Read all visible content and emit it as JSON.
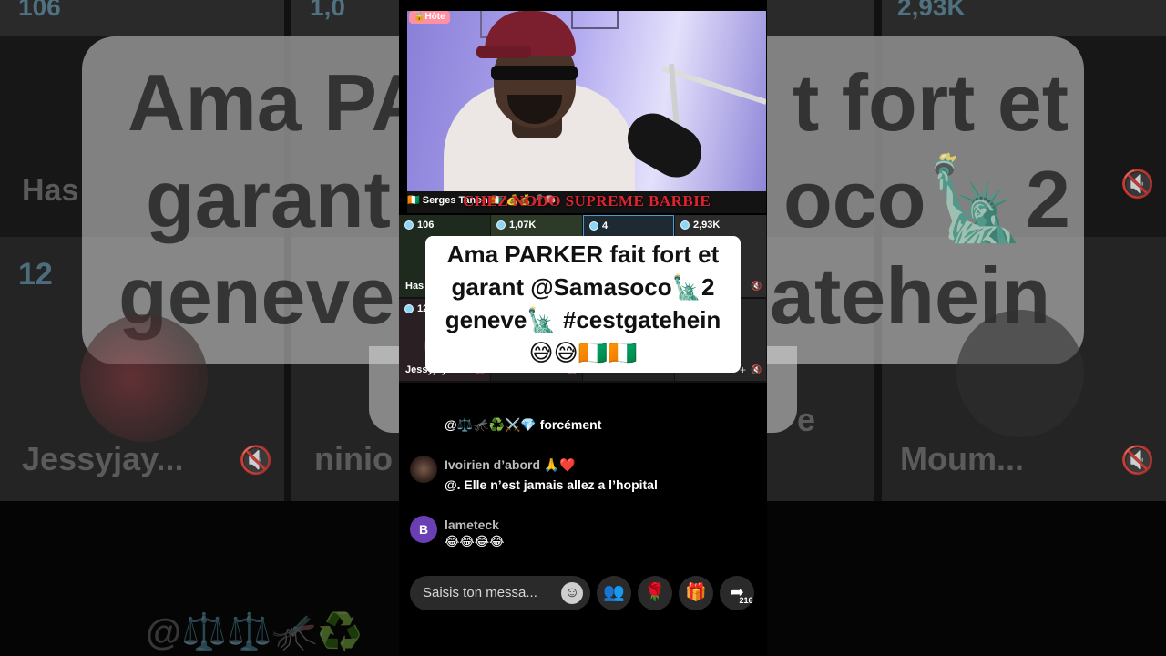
{
  "host": {
    "badge": "🔒Hôte",
    "name": "🇨🇮 Serges Tanoh 🇨🇮 💰💰🎤🧠",
    "overlay_text": "CHEZ NODO SUPREME BARBIE"
  },
  "guests": [
    {
      "coins": "106",
      "name": "Has"
    },
    {
      "coins": "1,07K",
      "name": ""
    },
    {
      "coins": "4",
      "name": ""
    },
    {
      "coins": "2,93K",
      "name": ""
    },
    {
      "coins": "12",
      "name": "Jessyjay..."
    },
    {
      "coins": "",
      "name": "niniofi..."
    },
    {
      "coins": "",
      "name": "e"
    },
    {
      "coins": "",
      "name": "Moum..."
    }
  ],
  "caption": {
    "line1": "Ama PARKER fait fort et",
    "line2": "garant @Samasoco🗽2",
    "line3": "geneve🗽 #cestgatehein",
    "line4": "😅😅🇨🇮🇨🇮"
  },
  "chat": [
    {
      "user": "",
      "text": "@⚖️🦟♻️⚔️💎 forcément"
    },
    {
      "user": "Ivoirien d’abord 🙏❤️",
      "text": "@. Elle n’est jamais allez a l’hopital"
    },
    {
      "user": "lameteck",
      "avatar_letter": "B",
      "text": "😂😂😂😂"
    }
  ],
  "input": {
    "placeholder": "Saisis ton messa...",
    "emoji_icon": "☺"
  },
  "actions": {
    "share_count": "216"
  },
  "background": {
    "coins_left": "106",
    "coins_mid": "1,0",
    "coins_right": "2,93K",
    "coins_row2": "12",
    "name_left": "Has",
    "name_row2_left": "Jessyjay...",
    "name_row2_mid": "ninio",
    "name_row2_right": "Moum...",
    "caption_l1_left": "Ama PA",
    "caption_l1_right": "t fort et",
    "caption_l2_left": "garant",
    "caption_l2_right": "oco🗽2",
    "caption_l3_left": "geneve",
    "caption_l3_right": "atehein",
    "chat_fragment": "@⚖️⚖️🦟♻️",
    "letter_e": "e"
  },
  "colors": {
    "accent_coin": "#8fd6f5",
    "overlay_red": "#e2232f",
    "host_badge": "#ff8fa3",
    "avatar_purple": "#6a3fb5"
  }
}
